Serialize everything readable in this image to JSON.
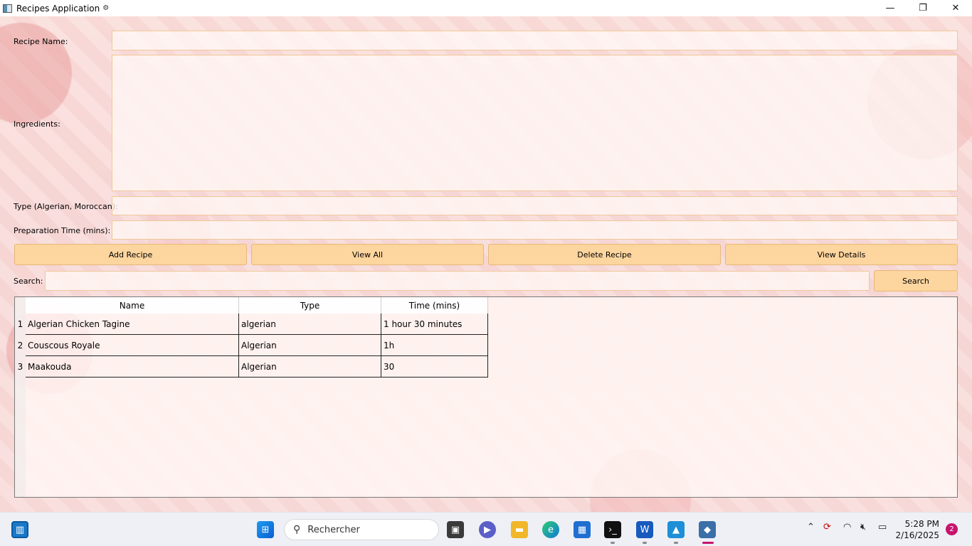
{
  "window": {
    "title": "Recipes Application",
    "title_icon": "gear-icon",
    "minimize": "—",
    "maximize": "❐",
    "close": "✕"
  },
  "form": {
    "recipe_name_label": "Recipe Name:",
    "recipe_name_value": "",
    "ingredients_label": "Ingredients:",
    "ingredients_value": "",
    "type_label": "Type (Algerian, Moroccan):",
    "type_value": "",
    "prep_time_label": "Preparation Time (mins):",
    "prep_time_value": ""
  },
  "actions": {
    "add": "Add Recipe",
    "view_all": "View All",
    "delete": "Delete Recipe",
    "view_details": "View Details"
  },
  "search": {
    "label": "Search:",
    "value": "",
    "button": "Search"
  },
  "table": {
    "columns": [
      "Name",
      "Type",
      "Time (mins)"
    ],
    "rows": [
      {
        "num": "1",
        "name": "Algerian Chicken Tagine",
        "type": "algerian",
        "time": "1 hour 30 minutes"
      },
      {
        "num": "2",
        "name": "Couscous Royale",
        "type": "Algerian",
        "time": "1h"
      },
      {
        "num": "3",
        "name": "Maakouda",
        "type": "Algerian",
        "time": "30"
      }
    ]
  },
  "taskbar": {
    "search_placeholder": "Rechercher",
    "time": "5:28 PM",
    "date": "2/16/2025",
    "notifications": "2"
  },
  "colors": {
    "button_bg": "#fdd59e",
    "field_border": "#f0c89a",
    "notification_badge": "#c8146e"
  }
}
